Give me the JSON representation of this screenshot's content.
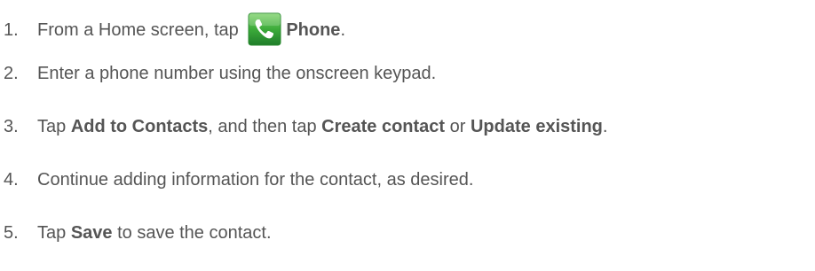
{
  "instructions": {
    "steps": [
      {
        "number": "1.",
        "parts": [
          "From a Home screen, tap ",
          "",
          "Phone",
          "."
        ]
      },
      {
        "number": "2.",
        "parts": [
          "Enter a phone number using the onscreen keypad."
        ]
      },
      {
        "number": "3.",
        "parts": [
          "Tap ",
          "Add to Contacts",
          ", and then tap ",
          "Create contact",
          " or ",
          "Update existing",
          "."
        ]
      },
      {
        "number": "4.",
        "parts": [
          "Continue adding information for the contact, as desired."
        ]
      },
      {
        "number": "5.",
        "parts": [
          "Tap ",
          "Save",
          " to save the contact."
        ]
      }
    ],
    "icon": "phone-icon",
    "colors": {
      "text": "#555555",
      "icon_green": "#3cab3a",
      "icon_green_dark": "#1f7d2a"
    }
  }
}
